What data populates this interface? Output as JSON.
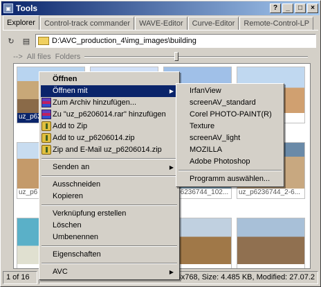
{
  "window": {
    "title": "Tools",
    "controls": {
      "help": "?",
      "minimize": "_",
      "maximize": "□",
      "close": "×"
    }
  },
  "tabs": [
    {
      "label": "Explorer",
      "active": true
    },
    {
      "label": "Control-track commander"
    },
    {
      "label": "WAVE-Editor"
    },
    {
      "label": "Curve-Editor"
    },
    {
      "label": "Remote-Control-LP"
    }
  ],
  "toolbar": {
    "path": "D:\\AVC_production_4\\img_images\\building",
    "icons": [
      "refresh-icon",
      "folder-icon"
    ]
  },
  "filterbar": {
    "arrow": "-->",
    "all_files": "All files",
    "folders": "Folders",
    "slider_position": 0.41
  },
  "thumbnails": [
    {
      "caption": "uz_p6206014",
      "selected": true
    },
    {
      "caption": ""
    },
    {
      "caption": ""
    },
    {
      "caption": ""
    },
    {
      "caption": "uz_p6"
    },
    {
      "caption": ""
    },
    {
      "caption": "uz_p6236744_102..."
    },
    {
      "caption": "uz_p6236744_2-6..."
    },
    {
      "caption": ""
    },
    {
      "caption": ""
    },
    {
      "caption": ""
    },
    {
      "caption": ""
    }
  ],
  "context_menu": {
    "items": [
      {
        "label": "Öffnen",
        "bold": true
      },
      {
        "label": "Öffnen mit",
        "submenu": true,
        "highlighted": true
      },
      {
        "label": "Zum Archiv hinzufügen...",
        "icon": "rar"
      },
      {
        "label": "Zu \"uz_p6206014.rar\" hinzufügen",
        "icon": "rar"
      },
      {
        "label": "Add to Zip",
        "icon": "zip"
      },
      {
        "label": "Add to uz_p6206014.zip",
        "icon": "zip"
      },
      {
        "label": "Zip and E-Mail uz_p6206014.zip",
        "icon": "zip"
      },
      {
        "separator": true
      },
      {
        "label": "Senden an",
        "submenu": true
      },
      {
        "separator": true
      },
      {
        "label": "Ausschneiden"
      },
      {
        "label": "Kopieren"
      },
      {
        "separator": true
      },
      {
        "label": "Verknüpfung erstellen"
      },
      {
        "label": "Löschen"
      },
      {
        "label": "Umbenennen"
      },
      {
        "separator": true
      },
      {
        "label": "Eigenschaften"
      },
      {
        "separator": true
      },
      {
        "label": "AVC",
        "submenu": true
      }
    ]
  },
  "submenu_open_with": {
    "items": [
      {
        "label": "IrfanView"
      },
      {
        "label": "screenAV_standard"
      },
      {
        "label": "Corel PHOTO-PAINT(R)"
      },
      {
        "label": "Texture"
      },
      {
        "label": "screenAV_light"
      },
      {
        "label": "MOZILLA"
      },
      {
        "label": "Adobe Photoshop"
      },
      {
        "separator": true
      },
      {
        "label": "Programm auswählen..."
      }
    ]
  },
  "statusbar": {
    "position": "1 of 16",
    "info": "4x768, Size: 4.485 KB, Modified: 27.07.2"
  }
}
